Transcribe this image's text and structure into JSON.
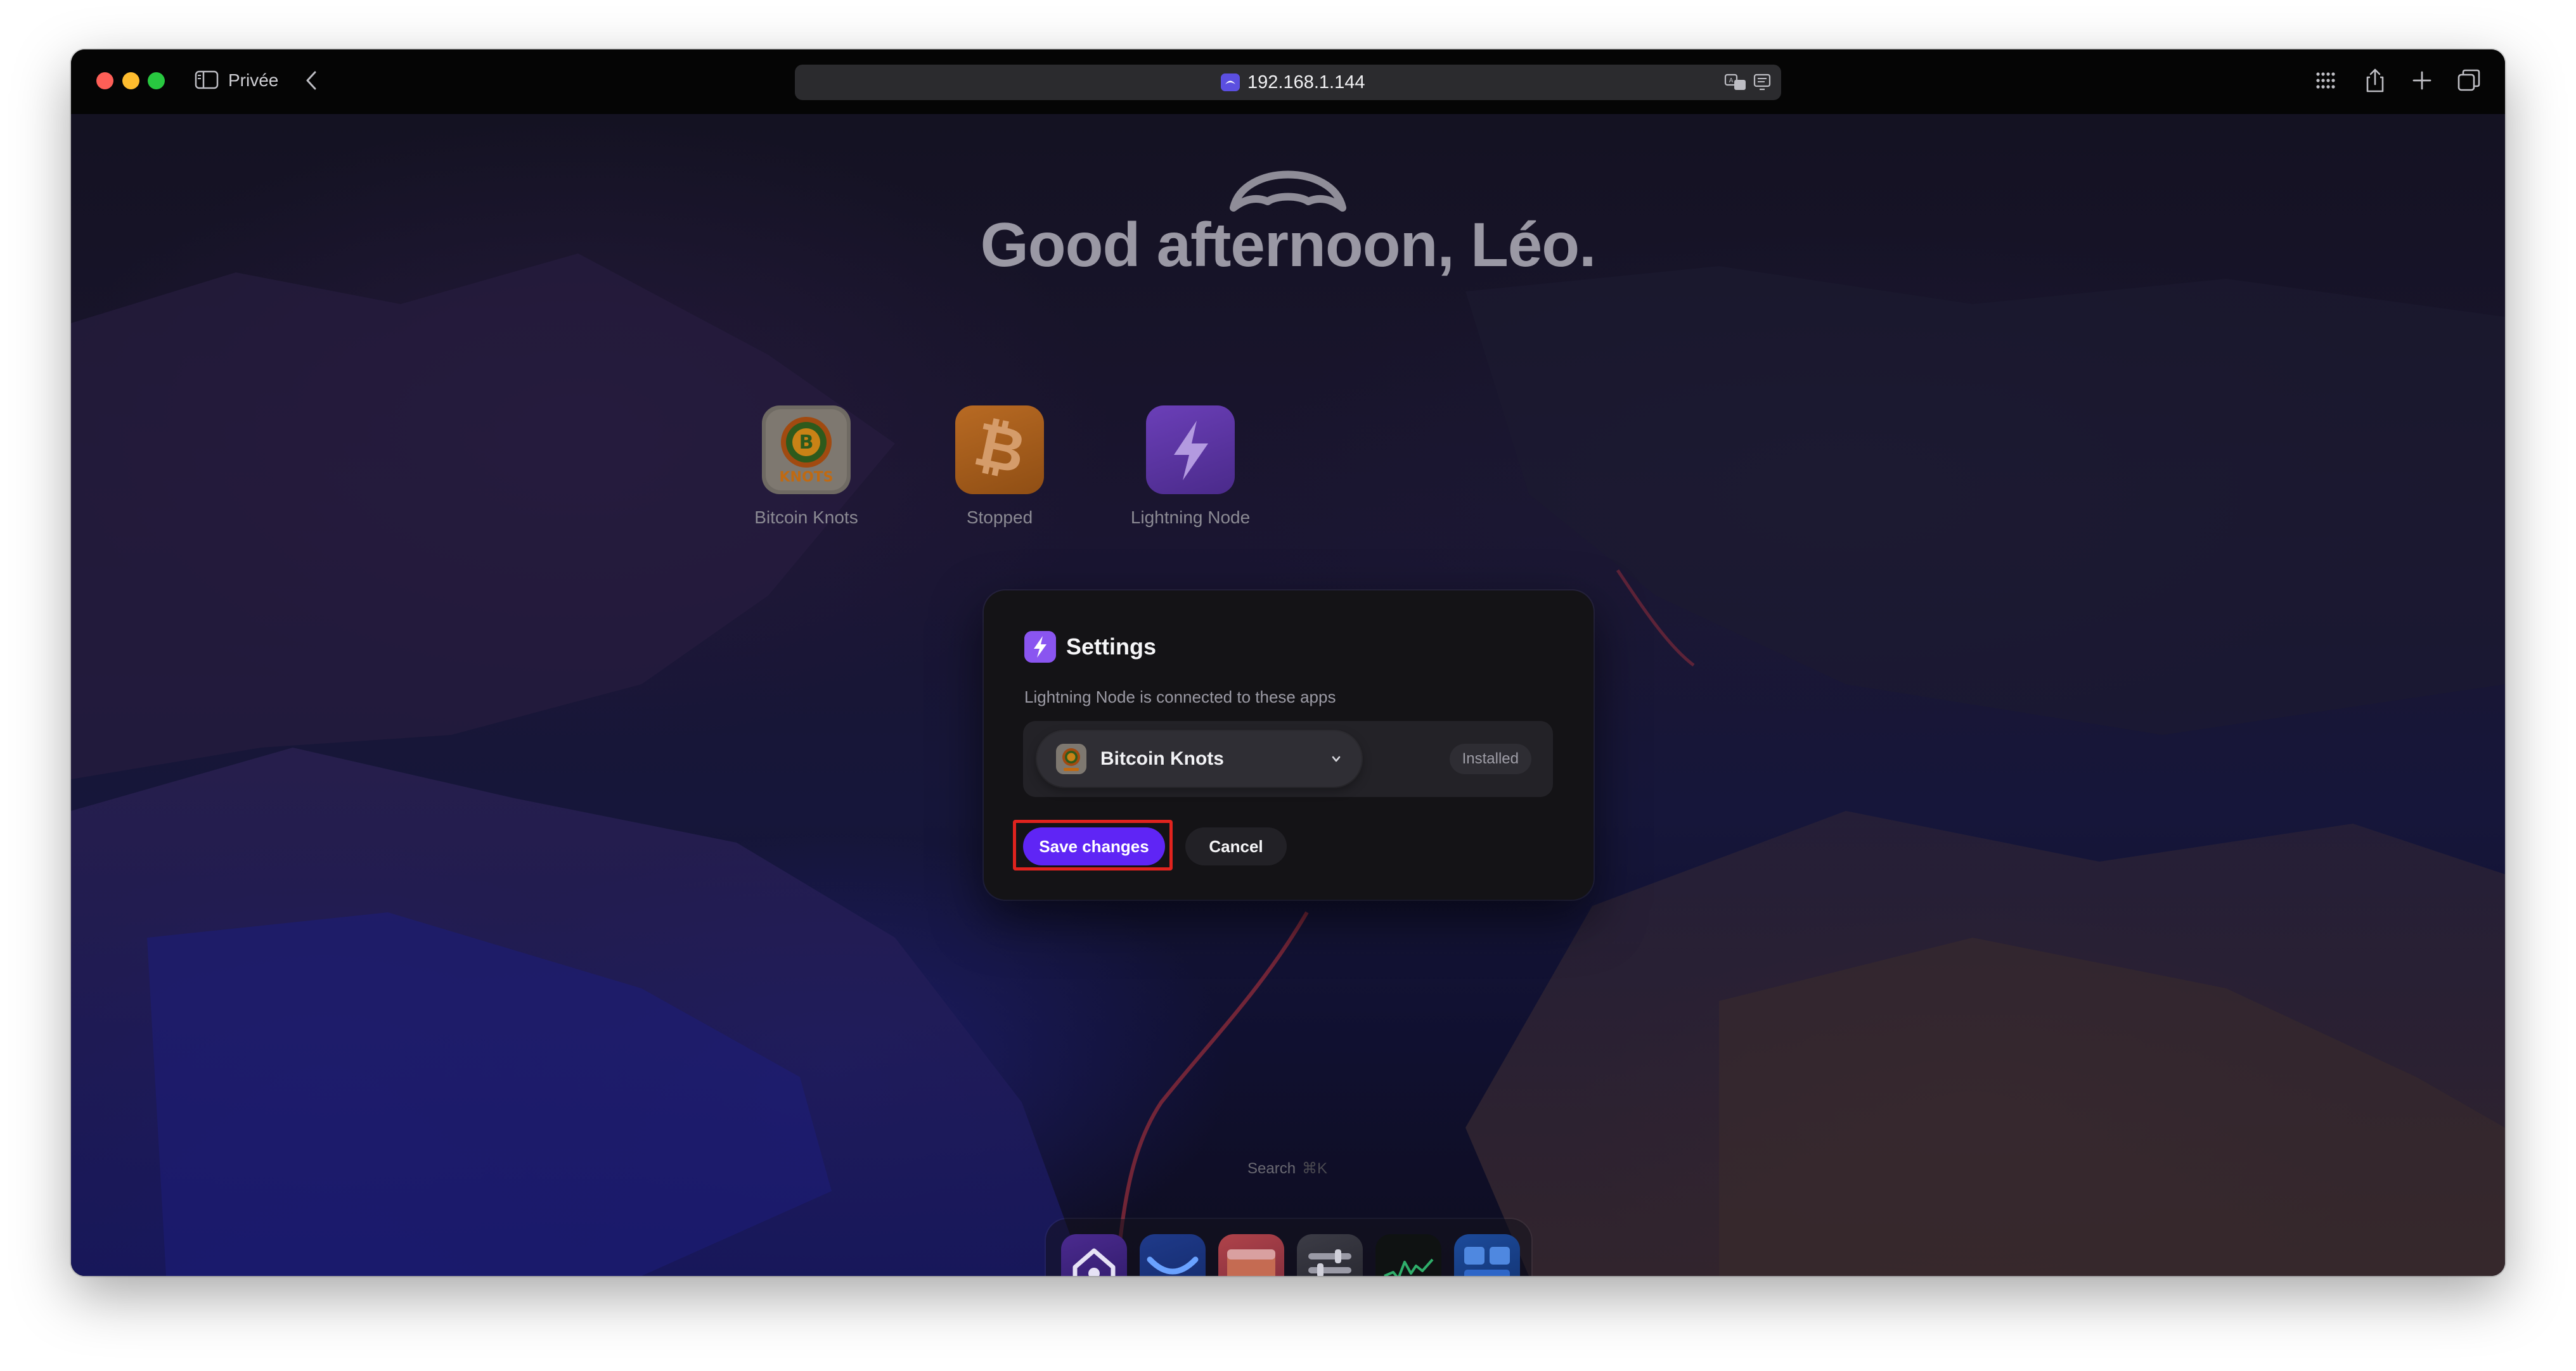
{
  "browser": {
    "private_label": "Privée",
    "url": "192.168.1.144",
    "icons": [
      "sidebar-icon",
      "chevron-left-icon",
      "translate-icon",
      "reader-icon",
      "grid-icon",
      "share-icon",
      "plus-icon",
      "tabs-icon"
    ]
  },
  "greeting": "Good afternoon, Léo.",
  "apps": [
    {
      "label": "Bitcoin Knots",
      "icon_text": "KNOTS"
    },
    {
      "label": "Stopped"
    },
    {
      "label": "Lightning Node"
    }
  ],
  "settings_dialog": {
    "title": "Settings",
    "description": "Lightning Node is connected to these apps",
    "selected_app": "Bitcoin Knots",
    "status": "Installed",
    "save_label": "Save changes",
    "cancel_label": "Cancel"
  },
  "search": {
    "label": "Search",
    "shortcut": "⌘K"
  },
  "dock": {
    "items": [
      "home-icon",
      "app-store-icon",
      "files-icon",
      "settings-icon",
      "live-usage-icon",
      "widgets-icon"
    ]
  },
  "colors": {
    "accent": "#5f25f5",
    "highlight": "#e0231e",
    "lightning": "#7c4dff",
    "bitcoin": "#f7931a"
  }
}
